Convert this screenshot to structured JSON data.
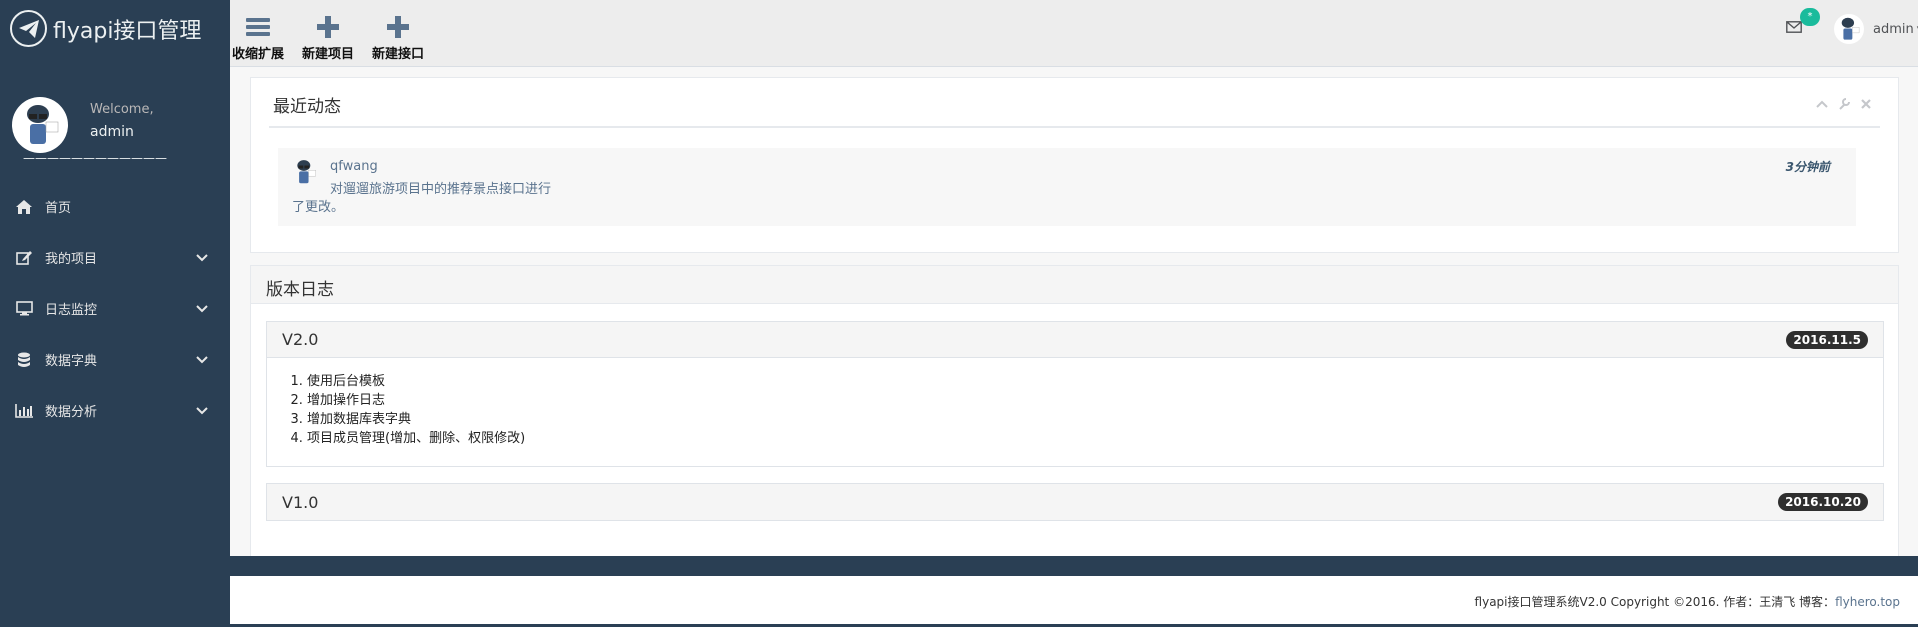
{
  "brand": {
    "title": "flyapi接口管理"
  },
  "profile": {
    "welcome": "Welcome,",
    "name": "admin",
    "separator": "————————————"
  },
  "sidebar": {
    "items": [
      {
        "label": "首页",
        "icon": "home-icon"
      },
      {
        "label": "我的项目",
        "icon": "edit-icon"
      },
      {
        "label": "日志监控",
        "icon": "desktop-icon"
      },
      {
        "label": "数据字典",
        "icon": "database-icon"
      },
      {
        "label": "数据分析",
        "icon": "bar-chart-icon"
      }
    ]
  },
  "toolbar": {
    "collapse_label": "收缩扩展",
    "new_project_label": "新建项目",
    "new_api_label": "新建接口"
  },
  "topbar": {
    "mail_badge": "*",
    "user_name": "admin"
  },
  "recent": {
    "title": "最近动态",
    "items": [
      {
        "user": "qfwang",
        "message_line1": "对遛遛旅游项目中的推荐景点接口进行",
        "message_line2": "了更改。",
        "time": "3分钟前"
      }
    ]
  },
  "changelog": {
    "title": "版本日志",
    "versions": [
      {
        "version": "V2.0",
        "date": "2016.11.5",
        "notes": [
          "使用后台模板",
          "增加操作日志",
          "增加数据库表字典",
          "项目成员管理(增加、删除、权限修改)"
        ]
      },
      {
        "version": "V1.0",
        "date": "2016.10.20"
      }
    ]
  },
  "footer": {
    "text": "flyapi接口管理系统V2.0  Copyright ©2016. 作者：王清飞 博客：",
    "link": "flyhero.top"
  },
  "colors": {
    "sidebar": "#2a3f54",
    "accent": "#1abb9c",
    "link": "#5a738e"
  }
}
